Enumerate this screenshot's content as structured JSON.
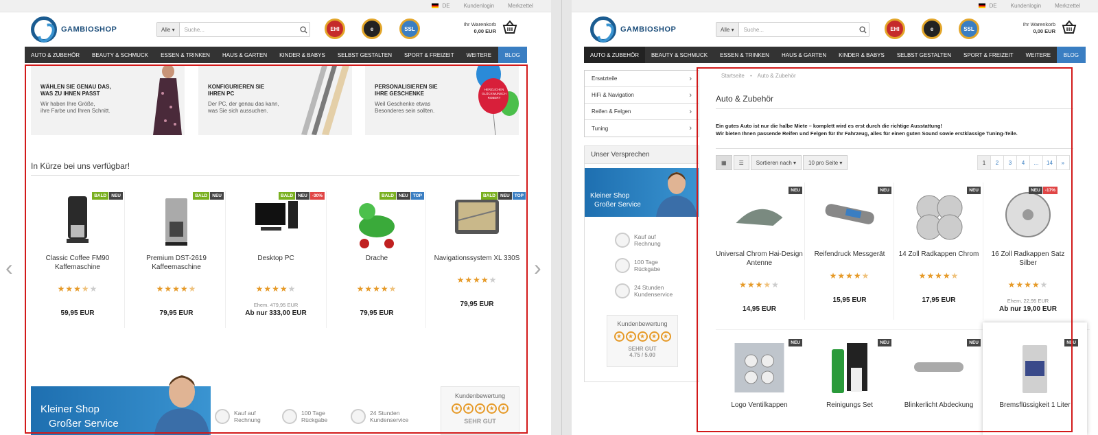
{
  "topbar": {
    "lang": "DE",
    "login": "Kundenlogin",
    "wishlist": "Merkzettel"
  },
  "logo": "GAMBIOSHOP",
  "search": {
    "select": "Alle ▾",
    "placeholder": "Suche..."
  },
  "seals": {
    "ehi": "EHI",
    "trusted": "e",
    "ssl": "SSL"
  },
  "cart": {
    "label": "Ihr Warenkorb",
    "total": "0,00 EUR"
  },
  "nav": {
    "items": [
      "AUTO & ZUBEHÖR",
      "BEAUTY & SCHMUCK",
      "ESSEN & TRINKEN",
      "HAUS & GARTEN",
      "KINDER & BABYS",
      "SELBST GESTALTEN",
      "SPORT & FREIZEIT",
      "WEITERE"
    ],
    "blog": "BLOG"
  },
  "left": {
    "banners": [
      {
        "title": "WÄHLEN SIE GENAU DAS,\nWAS ZU IHNEN PASST",
        "text": "Wir haben Ihre Größe,\nihre Farbe und Ihren Schnitt."
      },
      {
        "title": "KONFIGURIEREN SIE\nIHREN PC",
        "text": "Der PC, der genau das kann,\nwas Sie sich aussuchen."
      },
      {
        "title": "PERSONALISIEREN SIE\nIHRE GESCHENKE",
        "text": "Weil Geschenke etwas\nBesonderes sein sollten."
      }
    ],
    "balloon_text": "HERZLICHEN GLÜCKWUNSCH ROBERT",
    "section_title": "In Kürze bei uns verfügbar!",
    "products": [
      {
        "name": "Classic Coffee FM90 Kaffemaschine",
        "rating": 3.5,
        "old": "",
        "price": "59,95 EUR",
        "badges": [
          "BALD",
          "NEU"
        ]
      },
      {
        "name": "Premium DST-2619 Kaffeemaschine",
        "rating": 4.5,
        "old": "",
        "price": "79,95 EUR",
        "badges": [
          "BALD",
          "NEU"
        ]
      },
      {
        "name": "Desktop PC",
        "rating": 4,
        "old": "Ehem. 479,95 EUR",
        "price": "Ab nur 333,00 EUR",
        "badges": [
          "BALD",
          "NEU",
          "-30%"
        ]
      },
      {
        "name": "Drache",
        "rating": 4.5,
        "old": "",
        "price": "79,95 EUR",
        "badges": [
          "BALD",
          "NEU",
          "TOP"
        ]
      },
      {
        "name": "Navigationssystem XL 330S",
        "rating": 4,
        "old": "",
        "price": "79,95 EUR",
        "badges": [
          "BALD",
          "NEU",
          "TOP"
        ]
      }
    ],
    "promise": {
      "line1": "Kleiner Shop",
      "line2": "Großer Service"
    },
    "usps": [
      "Kauf auf\nRechnung",
      "100 Tage\nRückgabe",
      "24 Stunden\nKundenservice"
    ],
    "rating": {
      "title": "Kundenbewertung",
      "label": "SEHR GUT"
    }
  },
  "right": {
    "categories": [
      "Ersatzteile",
      "HiFi & Navigation",
      "Reifen & Felgen",
      "Tuning"
    ],
    "promise_title": "Unser Versprechen",
    "promise": {
      "line1": "Kleiner Shop",
      "line2": "Großer Service"
    },
    "usps": [
      "Kauf auf\nRechnung",
      "100 Tage\nRückgabe",
      "24 Stunden\nKundenservice"
    ],
    "rating": {
      "title": "Kundenbewertung",
      "label": "SEHR GUT",
      "score": "4.75 / 5.00"
    },
    "breadcrumb": [
      "Startseite",
      "Auto & Zubehör"
    ],
    "heading": "Auto & Zubehör",
    "intro1": "Ein gutes Auto ist nur die halbe Miete – komplett wird es erst durch die richtige Ausstattung!",
    "intro2": "Wir bieten Ihnen passende Reifen und Felgen für Ihr Fahrzeug, alles für einen guten Sound sowie erstklassige Tuning-Teile.",
    "sort": "Sortieren nach ▾",
    "per_page": "10 pro Seite ▾",
    "pages": [
      "1",
      "2",
      "3",
      "4",
      "...",
      "14",
      "»"
    ],
    "products": [
      {
        "name": "Universal Chrom Hai-Design Antenne",
        "rating": 3.5,
        "old": "",
        "price": "14,95 EUR",
        "badges": [
          "NEU"
        ]
      },
      {
        "name": "Reifendruck Messgerät",
        "rating": 4.5,
        "old": "",
        "price": "15,95 EUR",
        "badges": [
          "NEU"
        ]
      },
      {
        "name": "14 Zoll Radkappen Chrom",
        "rating": 4.5,
        "old": "",
        "price": "17,95 EUR",
        "badges": [
          "NEU"
        ]
      },
      {
        "name": "16 Zoll Radkappen Satz Silber",
        "rating": 4,
        "old": "Ehem. 22,95 EUR",
        "price": "Ab nur 19,00 EUR",
        "badges": [
          "NEU",
          "-17%"
        ]
      },
      {
        "name": "Logo Ventilkappen",
        "rating": 0,
        "old": "",
        "price": "",
        "badges": [
          "NEU"
        ]
      },
      {
        "name": "Reinigungs Set",
        "rating": 0,
        "old": "",
        "price": "",
        "badges": [
          "NEU"
        ]
      },
      {
        "name": "Blinkerlicht Abdeckung",
        "rating": 0,
        "old": "",
        "price": "",
        "badges": [
          "NEU"
        ]
      },
      {
        "name": "Bremsflüssigkeit 1 Liter",
        "rating": 0,
        "old": "",
        "price": "",
        "badges": [
          "NEU"
        ]
      }
    ]
  },
  "colors": {
    "nav": "#333333",
    "accent": "#3a7ec2",
    "highlight": "#d21919",
    "star": "#e69a28"
  }
}
